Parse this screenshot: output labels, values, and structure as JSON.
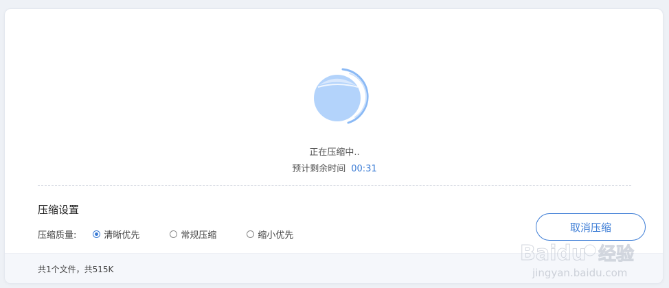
{
  "status": {
    "message": "正在压缩中..",
    "time_label": "预计剩余时间",
    "time_value": "00:31"
  },
  "settings": {
    "title": "压缩设置",
    "quality_label": "压缩质量:",
    "options": [
      {
        "label": "清晰优先",
        "selected": true
      },
      {
        "label": "常规压缩",
        "selected": false
      },
      {
        "label": "缩小优先",
        "selected": false
      }
    ],
    "cancel_label": "取消压缩"
  },
  "footer": {
    "file_info": "共1个文件，共515K"
  },
  "watermark": {
    "brand": "Baidu",
    "brand_cn": "经验",
    "url": "jingyan.baidu.com"
  },
  "colors": {
    "accent": "#3a7bd5",
    "progress_fill": "#b3d3fb",
    "progress_ring": "#8ab9f5"
  }
}
